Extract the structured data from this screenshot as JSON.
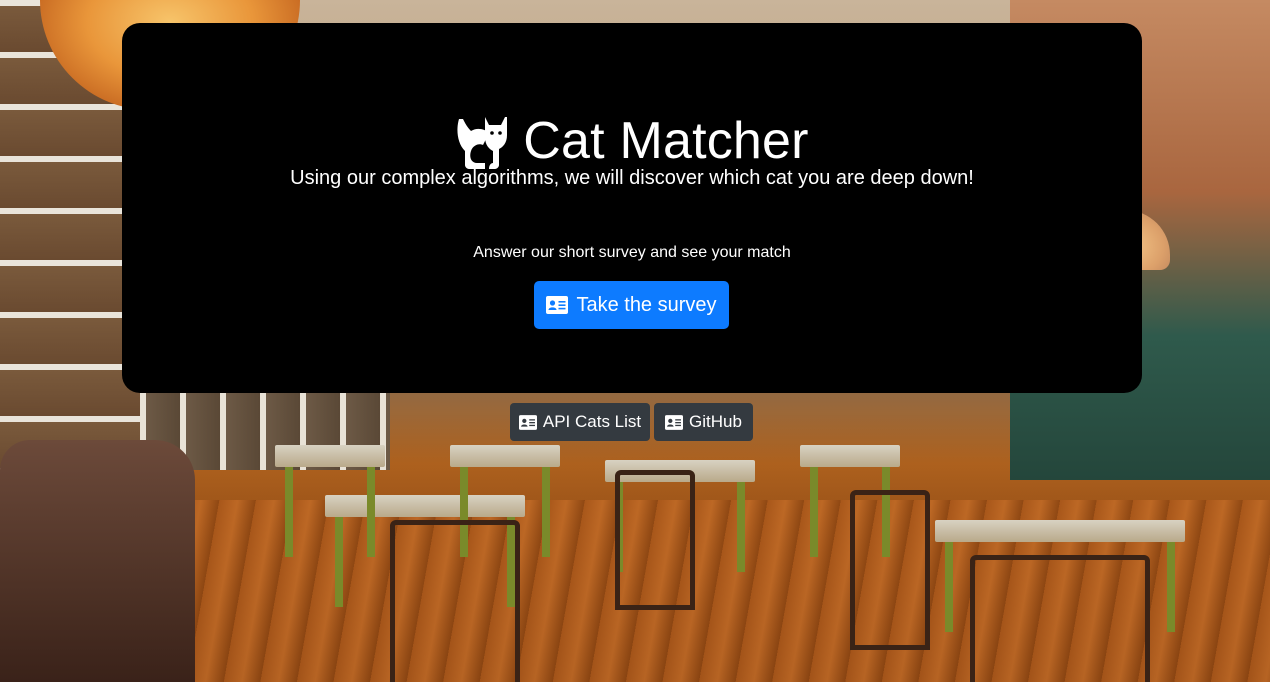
{
  "app": {
    "title": "Cat Matcher",
    "lead": "Using our complex algorithms, we will discover which cat you are deep down!",
    "logo_icon": "cat-icon"
  },
  "survey": {
    "prompt": "Answer our short survey and see your match",
    "button_label": "Take the survey",
    "button_icon": "id-card-icon"
  },
  "links": {
    "api_label": "API Cats List",
    "github_label": "GitHub",
    "icon": "id-card-icon"
  },
  "colors": {
    "primary": "#0d7bff",
    "dark_button": "#343a40",
    "panel": "#000000",
    "text": "#ffffff"
  }
}
